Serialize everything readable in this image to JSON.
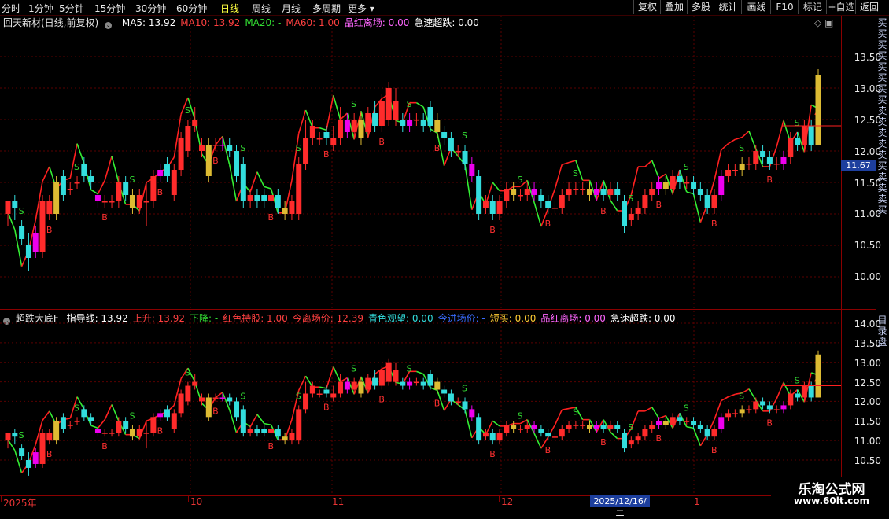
{
  "toolbar": {
    "periods": [
      "分时",
      "1分钟",
      "5分钟",
      "15分钟",
      "30分钟",
      "60分钟",
      "日线",
      "周线",
      "月线",
      "多周期",
      "更多"
    ],
    "active_period": "日线",
    "right_buttons": [
      "复权",
      "叠加",
      "多股",
      "统计",
      "画线",
      "F10",
      "标记",
      "+自选",
      "返回"
    ]
  },
  "main_panel": {
    "title": "回天新材(日线,前复权)",
    "indicators": [
      {
        "label": "MA5: 13.92",
        "color": "#ffffff"
      },
      {
        "label": "MA10: 13.92",
        "color": "#ff4040"
      },
      {
        "label": "MA20: -",
        "color": "#33dd33"
      },
      {
        "label": "MA60: 1.00",
        "color": "#ff4040"
      },
      {
        "label": "品红离场: 0.00",
        "color": "#ff66ff"
      },
      {
        "label": "急速超跌: 0.00",
        "color": "#ffffff"
      }
    ],
    "y_ticks": [
      "13.50",
      "13.00",
      "12.50",
      "12.00",
      "11.50",
      "11.00",
      "10.50",
      "10.00"
    ],
    "current_price": "11.67"
  },
  "sub_panel": {
    "title": "超跌大底F",
    "indicators": [
      {
        "label": "指导线: 13.92",
        "color": "#ffffff"
      },
      {
        "label": "上升: 13.92",
        "color": "#ff4040"
      },
      {
        "label": "下降: -",
        "color": "#33dd33"
      },
      {
        "label": "红色持股: 1.00",
        "color": "#ff4040"
      },
      {
        "label": "今离场价: 12.39",
        "color": "#ff4040"
      },
      {
        "label": "青色观望: 0.00",
        "color": "#33dddd"
      },
      {
        "label": "今进场价: -",
        "color": "#3a6cff"
      },
      {
        "label": "短买: 0.00",
        "color": "#ffcc33"
      },
      {
        "label": "品红离场: 0.00",
        "color": "#ff66ff"
      },
      {
        "label": "急速超跌: 0.00",
        "color": "#ffffff"
      }
    ],
    "y_ticks": [
      "14.00",
      "13.50",
      "13.00",
      "12.50",
      "12.00",
      "11.50",
      "11.00",
      "10.50"
    ]
  },
  "date_axis": {
    "labels": [
      "2025年",
      "10",
      "11",
      "12",
      "1"
    ],
    "cursor_date": "2025/12/16/二"
  },
  "watermark": {
    "line1": "乐淘公式网",
    "line2": "www.60lt.com"
  },
  "colors": {
    "up": "#ff2b2b",
    "down": "#33dddd",
    "magenta": "#ee00ee",
    "yellow": "#ddbb33",
    "rise_line": "#ff2020",
    "fall_line": "#33ee33",
    "guide_line": "#ffffff"
  },
  "chart_data": {
    "type": "candlestick",
    "candles": [
      [
        11.0,
        11.2,
        10.8,
        11.2
      ],
      [
        11.2,
        11.1,
        10.9,
        11.3
      ],
      [
        10.8,
        10.6,
        10.5,
        10.9
      ],
      [
        10.5,
        10.3,
        10.1,
        10.7
      ],
      [
        10.7,
        10.4,
        10.3,
        10.8
      ],
      [
        10.4,
        11.2,
        10.3,
        11.3
      ],
      [
        11.0,
        11.2,
        10.9,
        11.3
      ],
      [
        11.0,
        11.5,
        10.9,
        11.6
      ],
      [
        11.6,
        11.3,
        11.2,
        11.7
      ],
      [
        11.4,
        11.4,
        11.3,
        11.5
      ],
      [
        11.5,
        11.5,
        11.4,
        11.6
      ],
      [
        11.8,
        11.6,
        11.5,
        11.9
      ],
      [
        11.6,
        11.5,
        11.4,
        11.7
      ],
      [
        11.3,
        11.2,
        11.1,
        11.4
      ],
      [
        11.2,
        11.2,
        11.1,
        11.3
      ],
      [
        11.2,
        11.2,
        11.1,
        11.3
      ],
      [
        11.2,
        11.5,
        11.1,
        11.6
      ],
      [
        11.5,
        11.3,
        11.2,
        11.6
      ],
      [
        11.3,
        11.1,
        11.0,
        11.4
      ],
      [
        11.1,
        11.3,
        11.0,
        11.4
      ],
      [
        11.2,
        11.2,
        10.8,
        11.5
      ],
      [
        11.2,
        11.6,
        11.1,
        11.7
      ],
      [
        11.6,
        11.7,
        11.5,
        11.8
      ],
      [
        11.8,
        11.6,
        11.5,
        11.9
      ],
      [
        11.3,
        11.7,
        11.2,
        11.8
      ],
      [
        11.7,
        12.2,
        11.6,
        12.3
      ],
      [
        12.0,
        12.4,
        11.9,
        12.5
      ],
      [
        12.4,
        12.5,
        12.3,
        12.7
      ],
      [
        12.0,
        12.1,
        11.9,
        12.2
      ],
      [
        12.1,
        11.6,
        11.5,
        12.2
      ],
      [
        12.1,
        12.1,
        12.0,
        12.2
      ],
      [
        12.1,
        12.1,
        12.0,
        12.2
      ],
      [
        12.1,
        12.0,
        11.9,
        12.2
      ],
      [
        12.0,
        11.6,
        11.5,
        12.1
      ],
      [
        11.8,
        11.2,
        11.1,
        11.9
      ],
      [
        11.2,
        11.3,
        11.1,
        11.4
      ],
      [
        11.3,
        11.2,
        11.1,
        11.4
      ],
      [
        11.3,
        11.2,
        11.1,
        11.4
      ],
      [
        11.2,
        11.3,
        11.1,
        11.4
      ],
      [
        11.3,
        11.1,
        11.0,
        11.4
      ],
      [
        11.1,
        11.0,
        10.9,
        11.2
      ],
      [
        11.0,
        11.2,
        10.9,
        11.3
      ],
      [
        11.0,
        11.8,
        10.9,
        11.9
      ],
      [
        11.8,
        12.2,
        11.7,
        12.5
      ],
      [
        12.2,
        12.4,
        12.1,
        12.5
      ],
      [
        12.2,
        12.2,
        12.1,
        12.3
      ],
      [
        12.3,
        12.2,
        12.1,
        12.4
      ],
      [
        12.1,
        12.2,
        12.0,
        12.4
      ],
      [
        12.2,
        12.5,
        12.1,
        12.7
      ],
      [
        12.5,
        12.3,
        12.2,
        12.6
      ],
      [
        12.3,
        12.5,
        12.2,
        12.6
      ],
      [
        12.5,
        12.2,
        12.1,
        12.6
      ],
      [
        12.3,
        12.6,
        12.2,
        12.7
      ],
      [
        12.6,
        12.4,
        12.3,
        12.8
      ],
      [
        12.4,
        12.8,
        12.3,
        12.9
      ],
      [
        12.5,
        13.0,
        12.4,
        13.1
      ],
      [
        12.5,
        12.8,
        12.4,
        13.0
      ],
      [
        12.5,
        12.4,
        12.3,
        12.6
      ],
      [
        12.4,
        12.5,
        12.3,
        12.6
      ],
      [
        12.5,
        12.5,
        12.4,
        12.6
      ],
      [
        12.5,
        12.4,
        12.3,
        12.6
      ],
      [
        12.7,
        12.4,
        12.3,
        12.8
      ],
      [
        12.5,
        12.3,
        12.2,
        12.6
      ],
      [
        12.3,
        12.2,
        12.1,
        12.4
      ],
      [
        12.2,
        12.0,
        11.9,
        12.3
      ],
      [
        12.0,
        12.0,
        11.9,
        12.1
      ],
      [
        12.0,
        11.8,
        11.7,
        12.1
      ],
      [
        11.8,
        11.6,
        11.5,
        11.9
      ],
      [
        11.6,
        11.0,
        10.9,
        11.7
      ],
      [
        11.1,
        11.2,
        11.0,
        11.3
      ],
      [
        11.2,
        11.0,
        10.9,
        11.3
      ],
      [
        11.0,
        11.2,
        10.9,
        11.3
      ],
      [
        11.2,
        11.4,
        11.1,
        11.5
      ],
      [
        11.4,
        11.3,
        11.2,
        11.5
      ],
      [
        11.3,
        11.3,
        11.2,
        11.4
      ],
      [
        11.3,
        11.4,
        11.2,
        11.5
      ],
      [
        11.4,
        11.3,
        11.2,
        11.5
      ],
      [
        11.3,
        11.2,
        11.1,
        11.4
      ],
      [
        11.2,
        11.1,
        11.0,
        11.3
      ],
      [
        11.1,
        11.1,
        11.0,
        11.2
      ],
      [
        11.1,
        11.3,
        11.0,
        11.4
      ],
      [
        11.3,
        11.4,
        11.2,
        11.5
      ],
      [
        11.4,
        11.4,
        11.3,
        11.5
      ],
      [
        11.4,
        11.4,
        11.3,
        11.5
      ],
      [
        11.4,
        11.3,
        11.2,
        11.5
      ],
      [
        11.3,
        11.4,
        11.2,
        11.5
      ],
      [
        11.4,
        11.3,
        11.2,
        11.5
      ],
      [
        11.3,
        11.4,
        11.2,
        11.5
      ],
      [
        11.4,
        11.3,
        11.2,
        11.5
      ],
      [
        11.2,
        10.8,
        10.7,
        11.3
      ],
      [
        10.9,
        11.0,
        10.8,
        11.1
      ],
      [
        11.0,
        11.1,
        10.9,
        11.2
      ],
      [
        11.1,
        11.3,
        11.0,
        11.4
      ],
      [
        11.3,
        11.4,
        11.2,
        11.5
      ],
      [
        11.4,
        11.5,
        11.3,
        11.6
      ],
      [
        11.5,
        11.4,
        11.3,
        11.6
      ],
      [
        11.4,
        11.6,
        11.3,
        11.7
      ],
      [
        11.6,
        11.5,
        11.4,
        11.7
      ],
      [
        11.5,
        11.5,
        11.4,
        11.6
      ],
      [
        11.5,
        11.4,
        11.3,
        11.6
      ],
      [
        11.4,
        11.3,
        11.2,
        11.5
      ],
      [
        11.3,
        11.1,
        11.0,
        11.4
      ],
      [
        11.1,
        11.3,
        11.0,
        11.4
      ],
      [
        11.3,
        11.6,
        11.2,
        11.7
      ],
      [
        11.6,
        11.7,
        11.5,
        11.8
      ],
      [
        11.7,
        11.7,
        11.6,
        11.8
      ],
      [
        11.7,
        11.8,
        11.6,
        11.9
      ],
      [
        11.8,
        11.8,
        11.7,
        11.9
      ],
      [
        11.8,
        12.0,
        11.7,
        12.1
      ],
      [
        12.0,
        11.9,
        11.8,
        12.1
      ],
      [
        11.9,
        11.8,
        11.7,
        12.0
      ],
      [
        11.8,
        11.8,
        11.7,
        11.9
      ],
      [
        11.8,
        11.9,
        11.7,
        12.0
      ],
      [
        11.9,
        12.2,
        11.8,
        12.3
      ],
      [
        12.2,
        12.1,
        12.0,
        12.3
      ],
      [
        12.1,
        12.4,
        12.0,
        12.5
      ],
      [
        12.4,
        12.1,
        12.0,
        12.5
      ],
      [
        12.1,
        13.2,
        12.1,
        13.3
      ]
    ]
  }
}
